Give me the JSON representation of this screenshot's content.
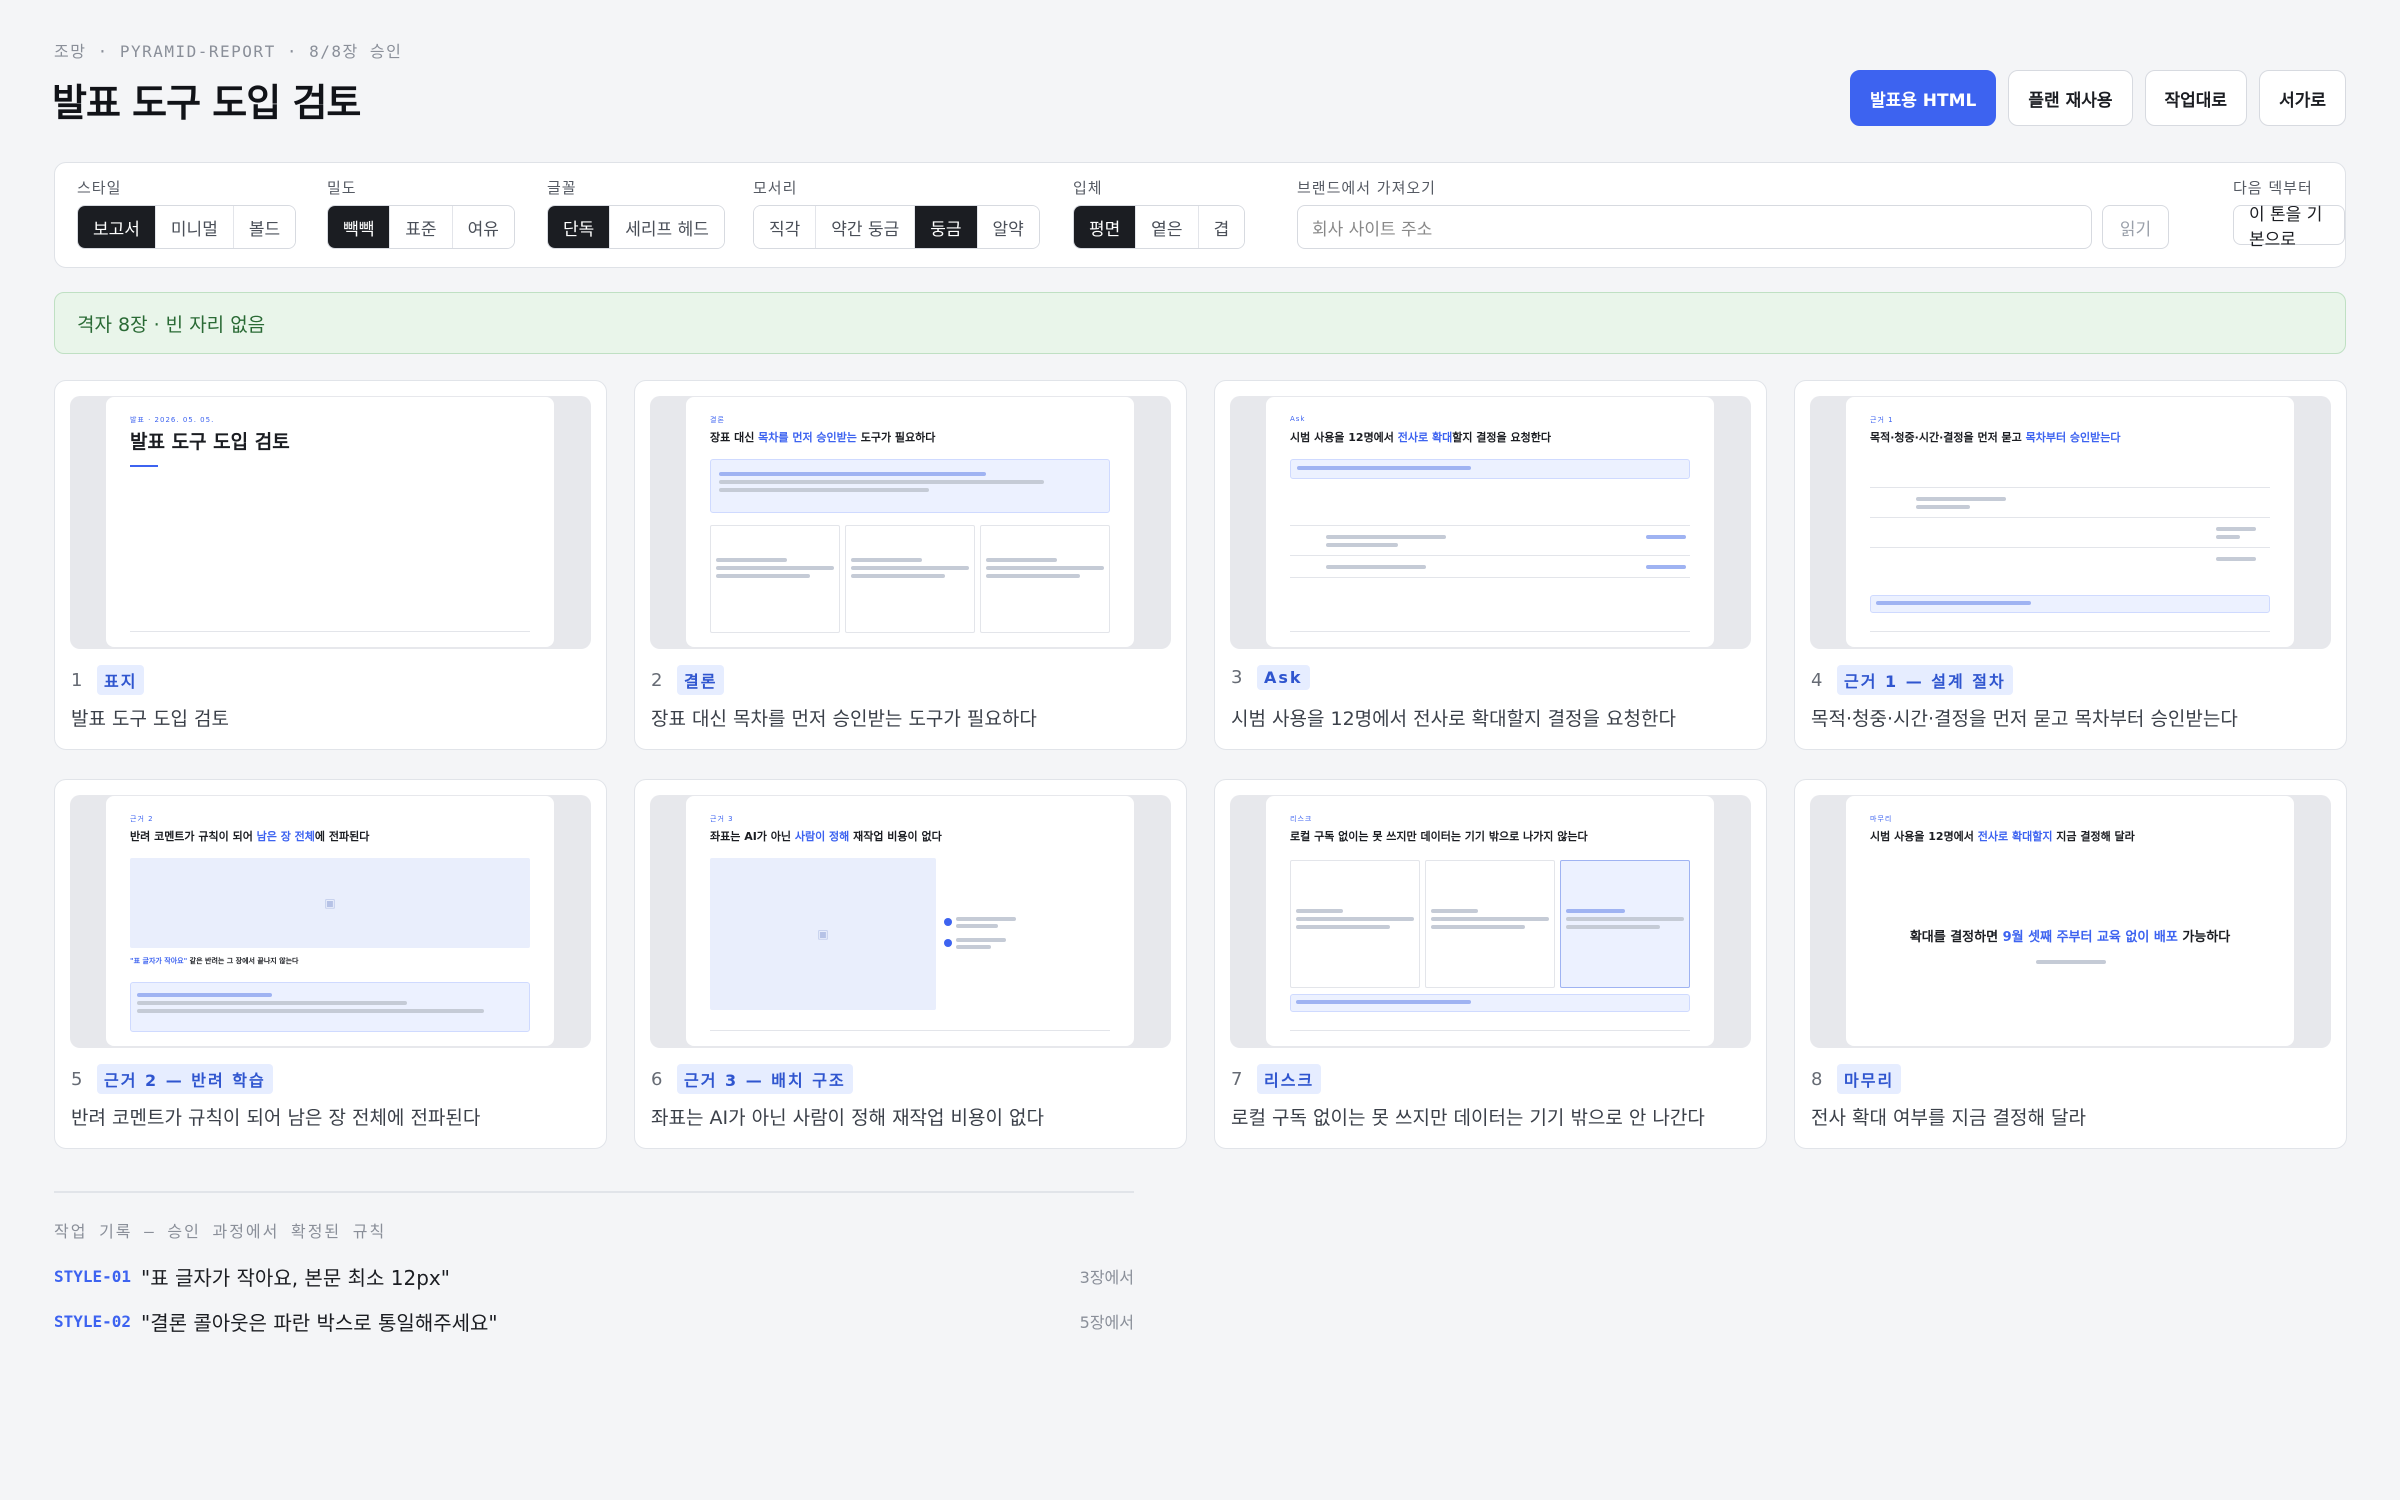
{
  "header": {
    "breadcrumb": "조망 · PYRAMID-REPORT · 8/8장 승인",
    "title": "발표 도구 도입 검토",
    "actions": [
      "발표용 HTML",
      "플랜 재사용",
      "작업대로",
      "서가로"
    ]
  },
  "toolbar": {
    "style": {
      "label": "스타일",
      "options": [
        "보고서",
        "미니멀",
        "볼드"
      ],
      "selected": "보고서"
    },
    "density": {
      "label": "밀도",
      "options": [
        "빽빽",
        "표준",
        "여유"
      ],
      "selected": "빽빽"
    },
    "font": {
      "label": "글꼴",
      "options": [
        "단독",
        "세리프 헤드"
      ],
      "selected": "단독"
    },
    "corner": {
      "label": "모서리",
      "options": [
        "직각",
        "약간 둥금",
        "둥금",
        "알약"
      ],
      "selected": "둥금"
    },
    "depth": {
      "label": "입체",
      "options": [
        "평면",
        "옅은",
        "겹"
      ],
      "selected": "평면"
    },
    "brand": {
      "label": "브랜드에서 가져오기",
      "placeholder": "회사 사이트 주소",
      "read_button": "읽기"
    },
    "next_deck": {
      "label": "다음 덱부터",
      "button": "이 톤을 기본으로"
    }
  },
  "banner": "격자 8장 · 빈 자리 없음",
  "slides": [
    {
      "num": "1",
      "tag": "표지",
      "title": "발표 도구 도입 검토"
    },
    {
      "num": "2",
      "tag": "결론",
      "title": "장표 대신 목차를 먼저 승인받는 도구가 필요하다"
    },
    {
      "num": "3",
      "tag": "Ask",
      "title": "시범 사용을 12명에서 전사로 확대할지 결정을 요청한다"
    },
    {
      "num": "4",
      "tag": "근거 1 — 설계 절차",
      "title": "목적·청중·시간·결정을 먼저 묻고 목차부터 승인받는다"
    },
    {
      "num": "5",
      "tag": "근거 2 — 반려 학습",
      "title": "반려 코멘트가 규칙이 되어 남은 장 전체에 전파된다"
    },
    {
      "num": "6",
      "tag": "근거 3 — 배치 구조",
      "title": "좌표는 AI가 아닌 사람이 정해 재작업 비용이 없다"
    },
    {
      "num": "7",
      "tag": "리스크",
      "title": "로컬 구독 없이는 못 쓰지만 데이터는 기기 밖으로 안 나간다"
    },
    {
      "num": "8",
      "tag": "마무리",
      "title": "전사 확대 여부를 지금 결정해 달라"
    }
  ],
  "thumbs": {
    "s1_kicker": "발표 · 2026. 05. 05.",
    "s2_pre": "장표 대신 ",
    "s2_hl": "목차를 먼저 승인받는",
    "s2_post": " 도구가 필요하다",
    "s3_pre": "시범 사용을 12명에서 ",
    "s3_hl": "전사로 확대",
    "s3_post": "할지 결정을 요청한다",
    "s4_pre": "목적·청중·시간·결정을 먼저 묻고 ",
    "s4_hl": "목차부터 승인받는다",
    "s5_pre": "반려 코멘트가 규칙이 되어 ",
    "s5_hl": "남은 장 전체",
    "s5_post": "에 전파된다",
    "s5_quote_hl": "\"표 글자가 작아요\"",
    "s5_quote_post": " 같은 반려는 그 장에서 끝나지 않는다",
    "s6_pre": "좌표는 AI가 아닌 ",
    "s6_hl": "사람이 정해",
    "s6_post": " 재작업 비용이 없다",
    "s7_title": "로컬 구독 없이는 못 쓰지만 데이터는 기기 밖으로 나가지 않는다",
    "s8_pre": "시범 사용을 12명에서 ",
    "s8_hl": "전사로 확대할지",
    "s8_post": " 지금 결정해 달라",
    "s8_big_pre": "확대를 결정하면 ",
    "s8_big_hl": "9월 셋째 주부터 교육 없이 배포",
    "s8_big_post": " 가능하다"
  },
  "log": {
    "title": "작업 기록 — 승인 과정에서 확정된 규칙",
    "rules": [
      {
        "id": "STYLE-01",
        "quote": "\"표 글자가 작아요, 본문 최소 12px\"",
        "where": "3장에서"
      },
      {
        "id": "STYLE-02",
        "quote": "\"결론 콜아웃은 파란 박스로 통일해주세요\"",
        "where": "5장에서"
      }
    ]
  },
  "colors": {
    "accent": "#3d63f0",
    "banner_bg": "#e9f5ea",
    "tag_bg": "#e6edff"
  }
}
